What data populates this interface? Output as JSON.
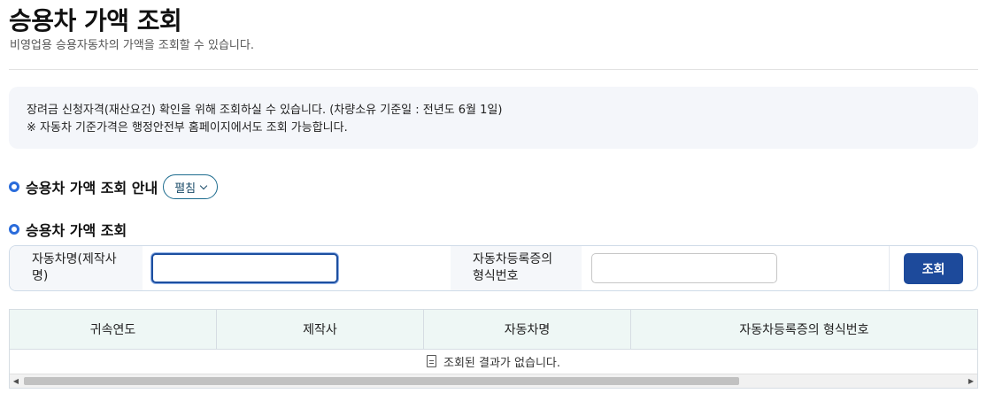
{
  "header": {
    "title": "승용차 가액 조회",
    "description": "비영업용 승용자동차의 가액을 조회할 수 있습니다."
  },
  "notice": {
    "line1": "장려금 신청자격(재산요건) 확인을 위해 조회하실 수 있습니다. (차량소유 기준일 : 전년도 6월 1일)",
    "line2": "※ 자동차 기준가격은 행정안전부 홈페이지에서도 조회 가능합니다."
  },
  "guide": {
    "title": "승용차 가액 조회 안내",
    "toggle_label": "펼침"
  },
  "search": {
    "title": "승용차 가액 조회",
    "car_name_label_line1": "자동차명(제작사",
    "car_name_label_line2": "명)",
    "car_name_value": "",
    "reg_type_label_line1": "자동차등록증의",
    "reg_type_label_line2": "형식번호",
    "reg_type_value": "",
    "button_label": "조회"
  },
  "table": {
    "columns": [
      "귀속연도",
      "제작사",
      "자동차명",
      "자동차등록증의 형식번호"
    ],
    "empty_message": "조회된 결과가 없습니다."
  },
  "scrollbar": {
    "left_arrow": "◀",
    "right_arrow": "▶"
  },
  "colors": {
    "primary_button": "#1d4a9b",
    "bullet": "#2a6cdb",
    "table_header_bg": "#eef7f5"
  }
}
